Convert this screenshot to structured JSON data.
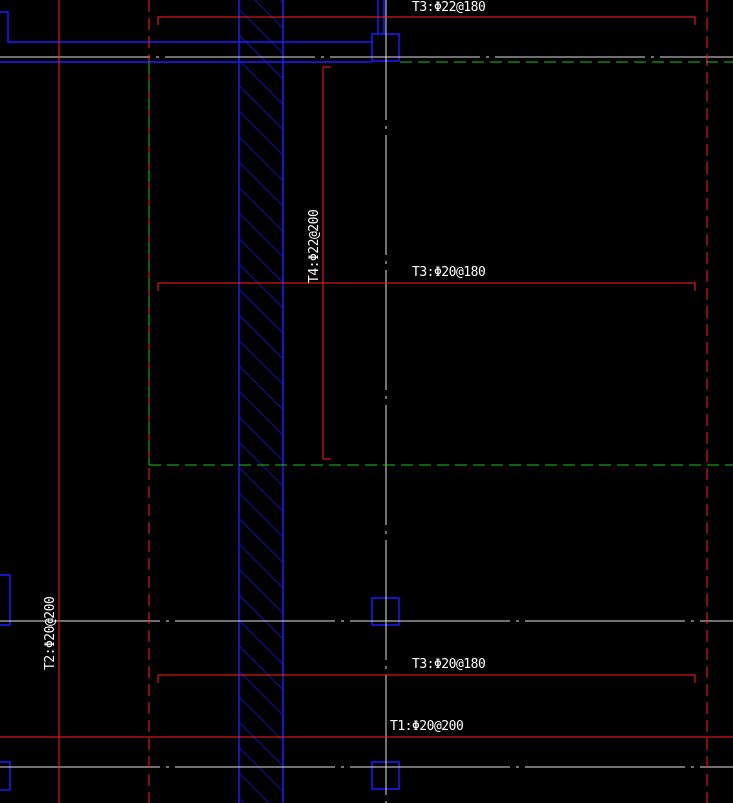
{
  "drawing": {
    "colors": {
      "background": "#000000",
      "rebar": "#ff2020",
      "wall": "#1a1aff",
      "axis": "#e0e0e0",
      "slab_boundary": "#19c419",
      "text": "#ffffff"
    },
    "annotations": {
      "t3_top": "T3:Φ22@180",
      "t3_mid": "T3:Φ20@180",
      "t3_low": "T3:Φ20@180",
      "t4": "T4:Φ22@200",
      "t2": "T2:Φ20@200",
      "t1": "T1:Φ20@200"
    }
  }
}
